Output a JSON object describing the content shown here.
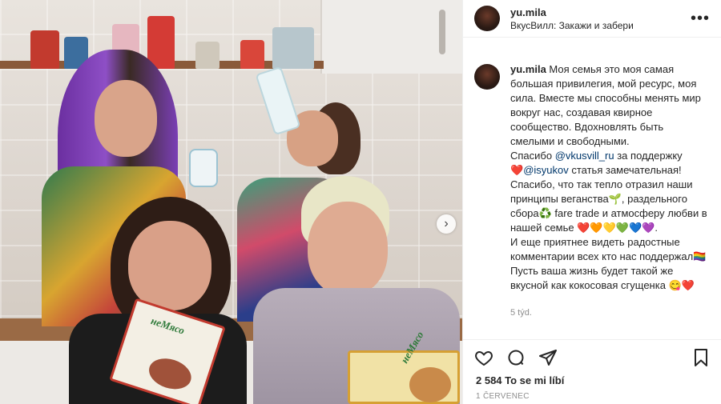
{
  "post": {
    "username": "yu.mila",
    "location": "ВкусВилл: Закажи и забери",
    "more_label": "•••"
  },
  "photo": {
    "product_label": "неМясо",
    "next_arrow": "›"
  },
  "caption": {
    "username": "yu.mila",
    "p1": "Моя семья это моя самая большая привилегия, мой ресурс, моя сила. Вместе мы способны менять мир вокруг нас, создавая квирное сообщество. Вдохновлять быть смелыми и свободными.",
    "p2a": "Спасибо ",
    "mention1": "@vkusvill_ru",
    "p2b": " за поддержку",
    "heart": "❤️",
    "mention2": "@isyukov",
    "p3": " статья замечательная!",
    "p4": "Спасибо, что так тепло отразил наши принципы веганства🌱, раздельного сбора♻️ fare trade и атмосферу любви в нашей семье ❤️🧡💛💚💙💜.",
    "p5": "И еще приятнее видеть радостные комментарии всех кто нас поддержал🏳️‍🌈",
    "p6": "Пусть ваша жизнь будет такой же вкусной как кокосовая сгущенка 😋❤️",
    "time_ago": "5 týd."
  },
  "footer": {
    "likes": "2 584 To se mi líbí",
    "date": "1 ČERVENEC"
  },
  "icons": [
    "heart-icon",
    "comment-icon",
    "share-icon",
    "bookmark-icon",
    "more-icon",
    "chevron-right-icon"
  ]
}
